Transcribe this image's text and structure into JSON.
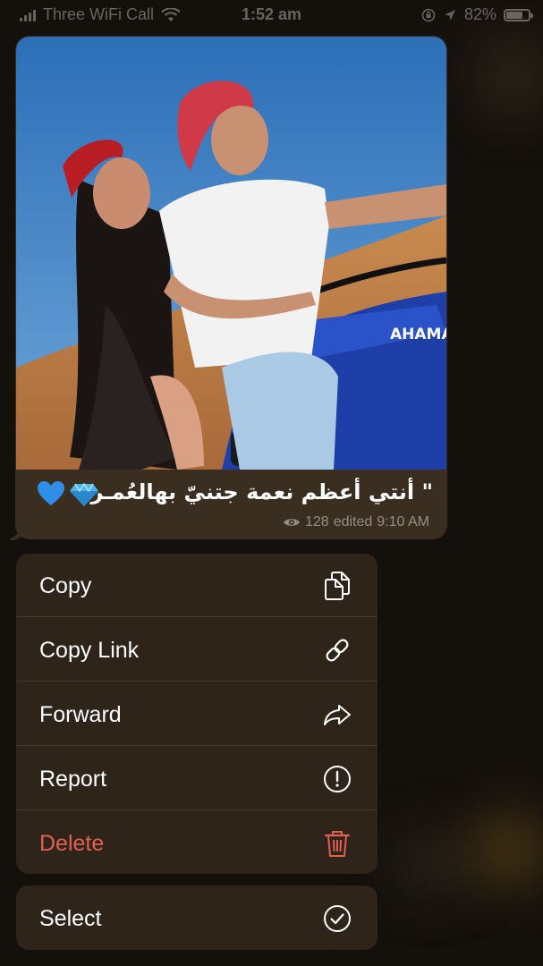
{
  "status_bar": {
    "carrier": "Three WiFi Call",
    "time": "1:52 am",
    "battery": "82%",
    "battery_level": 0.82
  },
  "message": {
    "caption": "\" أنتي أعظم نعمة جتنيّ بهالعُمـر",
    "views": "128",
    "edited_label": "edited",
    "time": "9:10 AM",
    "photo_text": "AHAMAY"
  },
  "context_menu": {
    "items": [
      {
        "label": "Copy",
        "icon": "copy-icon"
      },
      {
        "label": "Copy Link",
        "icon": "link-icon"
      },
      {
        "label": "Forward",
        "icon": "forward-icon"
      },
      {
        "label": "Report",
        "icon": "report-icon"
      },
      {
        "label": "Delete",
        "icon": "trash-icon"
      }
    ],
    "select_item": {
      "label": "Select",
      "icon": "checkmark-icon"
    }
  },
  "colors": {
    "background": "#14100c",
    "bubble": "#3a2e20",
    "menu": "#2e241a",
    "destructive": "#e06154"
  }
}
